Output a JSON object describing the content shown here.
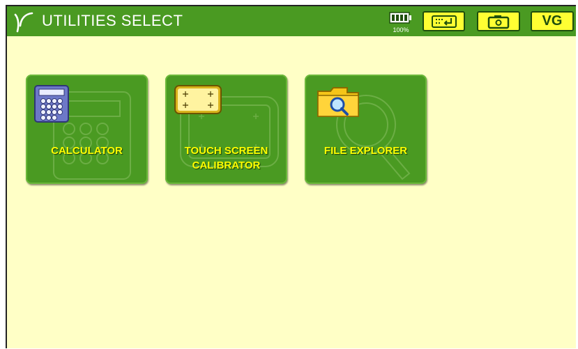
{
  "header": {
    "title": "UTILITIES SELECT",
    "battery_percent": "100%",
    "battery_level": 1.0,
    "buttons": {
      "keyboard_icon": "keyboard-icon",
      "camera_icon": "camera-icon",
      "vg_label": "VG"
    }
  },
  "tiles": [
    {
      "label": "CALCULATOR",
      "icon": "calculator-icon"
    },
    {
      "label_line1": "TOUCH SCREEN",
      "label_line2": "CALIBRATOR",
      "icon": "touch-screen-calibrator-icon"
    },
    {
      "label": "FILE EXPLORER",
      "icon": "file-explorer-icon"
    }
  ],
  "colors": {
    "accent": "#4a9a22",
    "background": "#ffffc6",
    "label": "#ffff00",
    "button": "#ffff33"
  }
}
